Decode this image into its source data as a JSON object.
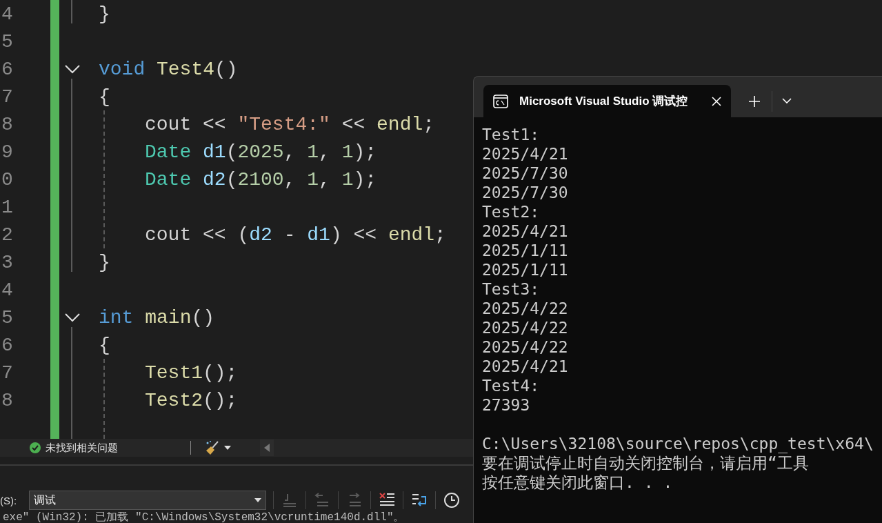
{
  "editor": {
    "lines": [
      {
        "number": "4",
        "fold": false,
        "indented": false,
        "tokens": [
          {
            "text": "}",
            "kind": "plain"
          }
        ]
      },
      {
        "number": "5",
        "fold": false,
        "indented": false
      },
      {
        "number": "6",
        "fold": true,
        "indented": false,
        "tokens": [
          {
            "text": "void ",
            "kind": "keyword"
          },
          {
            "text": "Test4",
            "kind": "function"
          },
          {
            "text": "()",
            "kind": "plain"
          }
        ]
      },
      {
        "number": "7",
        "fold": false,
        "indented": false,
        "tokens": [
          {
            "text": "{",
            "kind": "plain"
          }
        ]
      },
      {
        "number": "8",
        "fold": false,
        "indented": true,
        "tokens": [
          {
            "text": "cout << ",
            "kind": "plain"
          },
          {
            "text": "\"Test4:\"",
            "kind": "string"
          },
          {
            "text": " << ",
            "kind": "plain"
          },
          {
            "text": "endl",
            "kind": "function"
          },
          {
            "text": ";",
            "kind": "plain"
          }
        ]
      },
      {
        "number": "9",
        "fold": false,
        "indented": true,
        "tokens": [
          {
            "text": "Date ",
            "kind": "type"
          },
          {
            "text": "d1",
            "kind": "variable"
          },
          {
            "text": "(",
            "kind": "plain"
          },
          {
            "text": "2025",
            "kind": "number"
          },
          {
            "text": ", ",
            "kind": "plain"
          },
          {
            "text": "1",
            "kind": "number"
          },
          {
            "text": ", ",
            "kind": "plain"
          },
          {
            "text": "1",
            "kind": "number"
          },
          {
            "text": ");",
            "kind": "plain"
          }
        ]
      },
      {
        "number": "0",
        "fold": false,
        "indented": true,
        "tokens": [
          {
            "text": "Date ",
            "kind": "type"
          },
          {
            "text": "d2",
            "kind": "variable"
          },
          {
            "text": "(",
            "kind": "plain"
          },
          {
            "text": "2100",
            "kind": "number"
          },
          {
            "text": ", ",
            "kind": "plain"
          },
          {
            "text": "1",
            "kind": "number"
          },
          {
            "text": ", ",
            "kind": "plain"
          },
          {
            "text": "1",
            "kind": "number"
          },
          {
            "text": ");",
            "kind": "plain"
          }
        ]
      },
      {
        "number": "1",
        "fold": false,
        "indented": false
      },
      {
        "number": "2",
        "fold": false,
        "indented": true,
        "tokens": [
          {
            "text": "cout << (",
            "kind": "plain"
          },
          {
            "text": "d2",
            "kind": "variable"
          },
          {
            "text": " - ",
            "kind": "plain"
          },
          {
            "text": "d1",
            "kind": "variable"
          },
          {
            "text": ") << ",
            "kind": "plain"
          },
          {
            "text": "endl",
            "kind": "function"
          },
          {
            "text": ";",
            "kind": "plain"
          }
        ]
      },
      {
        "number": "3",
        "fold": false,
        "indented": false,
        "tokens": [
          {
            "text": "}",
            "kind": "plain"
          }
        ]
      },
      {
        "number": "4",
        "fold": false,
        "indented": false
      },
      {
        "number": "5",
        "fold": true,
        "indented": false,
        "tokens": [
          {
            "text": "int ",
            "kind": "keyword"
          },
          {
            "text": "main",
            "kind": "function"
          },
          {
            "text": "()",
            "kind": "plain"
          }
        ]
      },
      {
        "number": "6",
        "fold": false,
        "indented": false,
        "tokens": [
          {
            "text": "{",
            "kind": "plain"
          }
        ]
      },
      {
        "number": "7",
        "fold": false,
        "indented": true,
        "tokens": [
          {
            "text": "Test1",
            "kind": "function"
          },
          {
            "text": "();",
            "kind": "plain"
          }
        ]
      },
      {
        "number": "8",
        "fold": false,
        "indented": true,
        "tokens": [
          {
            "text": "Test2",
            "kind": "function"
          },
          {
            "text": "();",
            "kind": "plain"
          }
        ]
      }
    ]
  },
  "status_bar": {
    "message": "未找到相关问题",
    "ok": true
  },
  "output_panel": {
    "source_label": "(S):",
    "source_value": "调试",
    "toolbar": [
      {
        "kind": "find-source",
        "disabled": true
      },
      {
        "kind": "previous",
        "disabled": true
      },
      {
        "kind": "next",
        "disabled": true
      },
      {
        "kind": "clear",
        "disabled": false
      },
      {
        "kind": "wrap",
        "disabled": false
      },
      {
        "kind": "clock",
        "disabled": false
      }
    ],
    "output_line": "exe\" (Win32): 已加载 \"C:\\Windows\\System32\\vcruntime140d.dll\"。"
  },
  "terminal": {
    "tab_title": "Microsoft Visual Studio 调试控",
    "output": [
      "Test1:",
      "2025/4/21",
      "2025/7/30",
      "2025/7/30",
      "Test2:",
      "2025/4/21",
      "2025/1/11",
      "2025/1/11",
      "Test3:",
      "2025/4/22",
      "2025/4/22",
      "2025/4/22",
      "2025/4/21",
      "Test4:",
      "27393"
    ],
    "footer": [
      "C:\\Users\\32108\\source\\repos\\cpp_test\\x64\\",
      "要在调试停止时自动关闭控制台，请启用“工具",
      "按任意键关闭此窗口. . ."
    ]
  }
}
